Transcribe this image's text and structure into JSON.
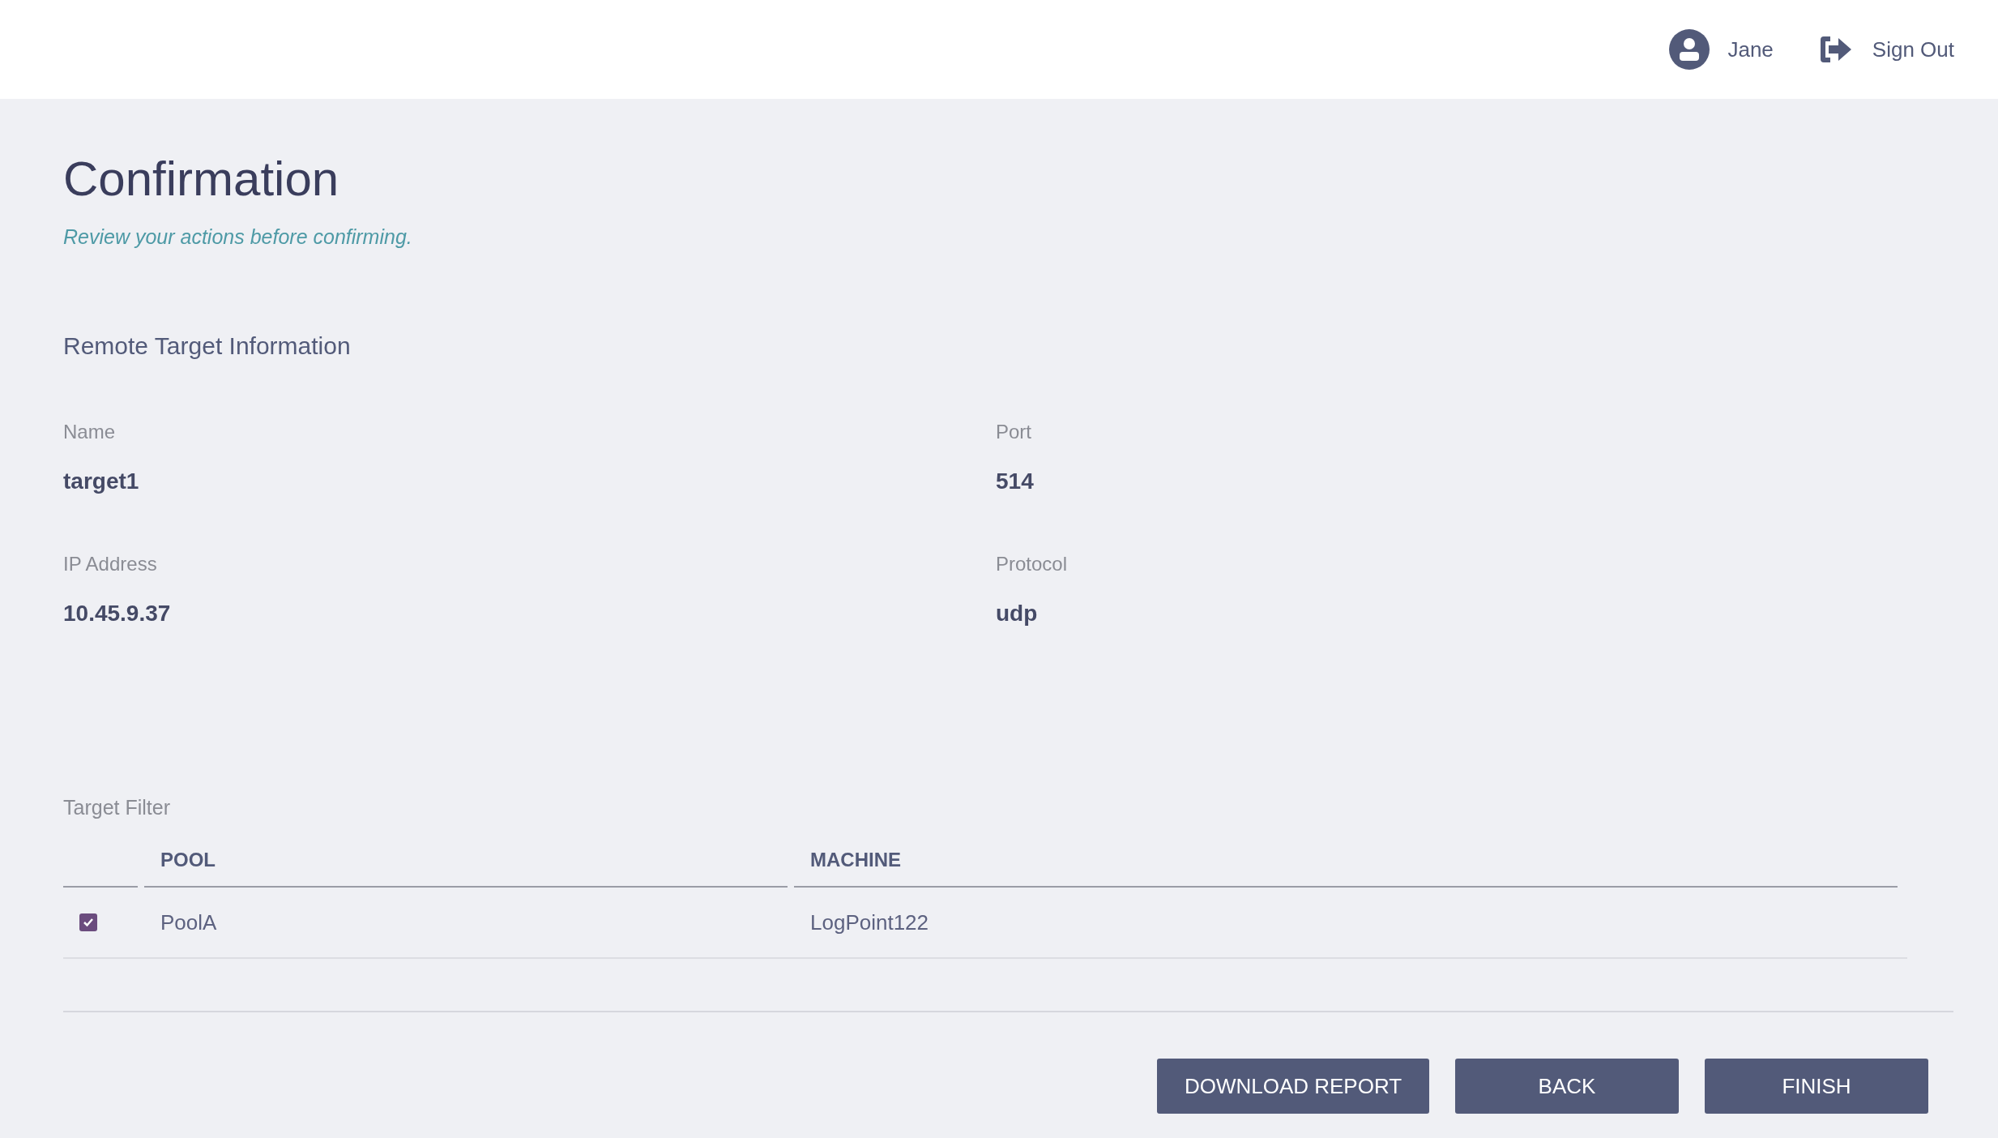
{
  "header": {
    "user": "Jane",
    "sign_out": "Sign Out"
  },
  "title": "Confirmation",
  "subtitle": "Review your actions before confirming.",
  "section": {
    "heading": "Remote Target Information",
    "fields": [
      {
        "label": "Name",
        "value": "target1"
      },
      {
        "label": "Port",
        "value": "514"
      },
      {
        "label": "IP Address",
        "value": "10.45.9.37"
      },
      {
        "label": "Protocol",
        "value": "udp"
      }
    ]
  },
  "target_filter": {
    "label": "Target Filter",
    "columns": [
      "POOL",
      "MACHINE"
    ],
    "rows": [
      {
        "checked": true,
        "pool": "PoolA",
        "machine": "LogPoint122"
      }
    ]
  },
  "buttons": [
    "DOWNLOAD REPORT",
    "BACK",
    "FINISH"
  ]
}
